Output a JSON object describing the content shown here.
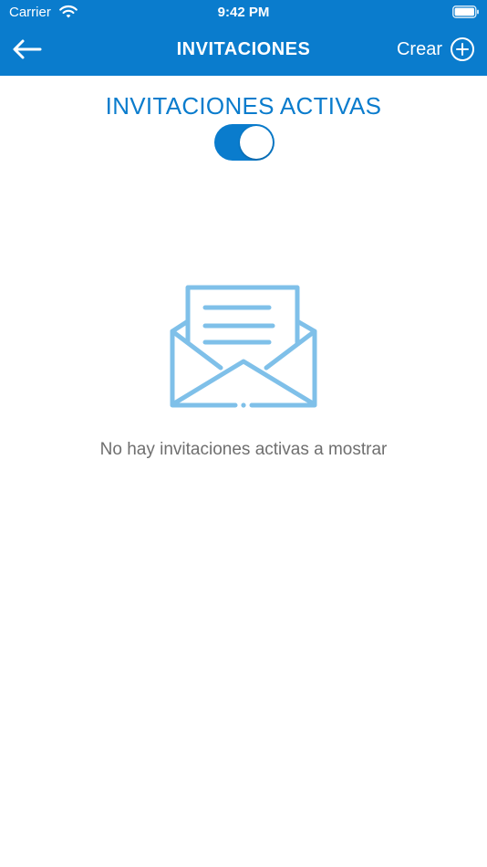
{
  "status_bar": {
    "carrier": "Carrier",
    "time": "9:42 PM",
    "wifi_icon": "wifi-icon",
    "battery_icon": "battery-icon"
  },
  "nav": {
    "title": "INVITACIONES",
    "back_icon": "arrow-left-icon",
    "create_label": "Crear",
    "create_icon": "plus-circle-icon"
  },
  "section": {
    "title": "INVITACIONES ACTIVAS",
    "toggle_on": true
  },
  "empty_state": {
    "icon": "open-envelope-icon",
    "message": "No hay invitaciones activas a mostrar"
  },
  "colors": {
    "primary": "#0a7ccd",
    "icon_light": "#7fc0e9",
    "muted_text": "#6f6f6f",
    "background": "#ffffff"
  }
}
